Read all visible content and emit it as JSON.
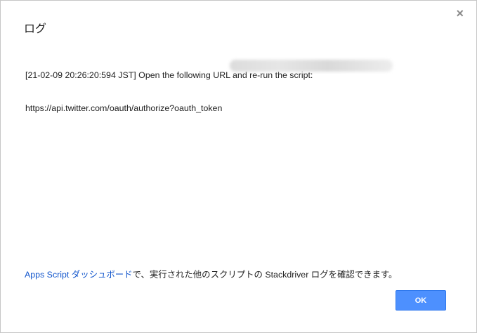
{
  "dialog": {
    "title": "ログ",
    "close_glyph": "×",
    "close_icon": "close-icon"
  },
  "log": {
    "line1": "[21-02-09 20:26:20:594 JST] Open the following URL and re-run the script:",
    "line2": "https://api.twitter.com/oauth/authorize?oauth_token"
  },
  "footer": {
    "link_text": "Apps Script ダッシュボード",
    "text": "で、実行された他のスクリプトの Stackdriver ログを確認できます。"
  },
  "buttons": {
    "ok_label": "OK"
  },
  "colors": {
    "accent": "#4d90fe",
    "link": "#1155cc"
  }
}
